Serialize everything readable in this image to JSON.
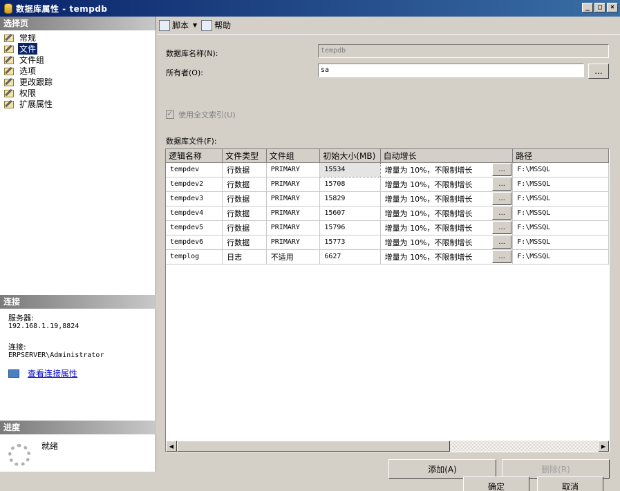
{
  "window": {
    "title": "数据库属性 - tempdb",
    "minimize_glyph": "_",
    "maximize_glyph": "□",
    "close_glyph": "×"
  },
  "left": {
    "select_page_header": "选择页",
    "nav_items": [
      {
        "label": "常规"
      },
      {
        "label": "文件"
      },
      {
        "label": "文件组"
      },
      {
        "label": "选项"
      },
      {
        "label": "更改跟踪"
      },
      {
        "label": "权限"
      },
      {
        "label": "扩展属性"
      }
    ],
    "selected_index": 1,
    "connection": {
      "header": "连接",
      "server_label": "服务器:",
      "server_value": "192.168.1.19,8824",
      "connection_label": "连接:",
      "connection_value": "ERPSERVER\\Administrator",
      "link_text": "查看连接属性"
    },
    "progress": {
      "header": "进度",
      "status": "就绪"
    }
  },
  "toolbar": {
    "script_label": "脚本",
    "help_label": "帮助"
  },
  "form": {
    "db_name_label": "数据库名称(N):",
    "db_name_value": "tempdb",
    "owner_label": "所有者(O):",
    "owner_value": "sa",
    "owner_browse": "...",
    "fulltext_label": "使用全文索引(U)",
    "files_label": "数据库文件(F):"
  },
  "files_table": {
    "columns": [
      "逻辑名称",
      "文件类型",
      "文件组",
      "初始大小(MB)",
      "自动增长",
      "路径"
    ],
    "rows": [
      {
        "name": "tempdev",
        "type": "行数据",
        "group": "PRIMARY",
        "size": "15534",
        "growth": "增量为 10%，不限制增长",
        "path": "F:\\MSSQL"
      },
      {
        "name": "tempdev2",
        "type": "行数据",
        "group": "PRIMARY",
        "size": "15708",
        "growth": "增量为 10%，不限制增长",
        "path": "F:\\MSSQL"
      },
      {
        "name": "tempdev3",
        "type": "行数据",
        "group": "PRIMARY",
        "size": "15829",
        "growth": "增量为 10%，不限制增长",
        "path": "F:\\MSSQL"
      },
      {
        "name": "tempdev4",
        "type": "行数据",
        "group": "PRIMARY",
        "size": "15607",
        "growth": "增量为 10%，不限制增长",
        "path": "F:\\MSSQL"
      },
      {
        "name": "tempdev5",
        "type": "行数据",
        "group": "PRIMARY",
        "size": "15796",
        "growth": "增量为 10%，不限制增长",
        "path": "F:\\MSSQL"
      },
      {
        "name": "tempdev6",
        "type": "行数据",
        "group": "PRIMARY",
        "size": "15773",
        "growth": "增量为 10%，不限制增长",
        "path": "F:\\MSSQL"
      },
      {
        "name": "templog",
        "type": "日志",
        "group": "不适用",
        "size": "6627",
        "growth": "增量为 10%，不限制增长",
        "path": "F:\\MSSQL"
      }
    ],
    "ellipsis": "..."
  },
  "buttons": {
    "add": "添加(A)",
    "remove": "删除(R)",
    "ok": "确定",
    "cancel": "取消"
  }
}
